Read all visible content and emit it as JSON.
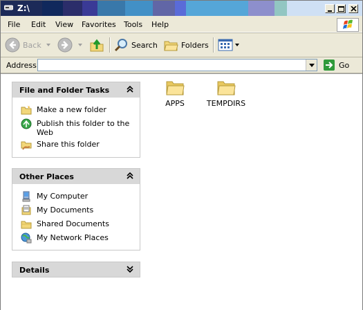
{
  "window": {
    "title": "Z:\\"
  },
  "menubar": {
    "items": [
      {
        "label": "File"
      },
      {
        "label": "Edit"
      },
      {
        "label": "View"
      },
      {
        "label": "Favorites"
      },
      {
        "label": "Tools"
      },
      {
        "label": "Help"
      }
    ]
  },
  "toolbar": {
    "back_label": "Back",
    "search_label": "Search",
    "folders_label": "Folders"
  },
  "addressbar": {
    "label": "Address",
    "value": "",
    "go_label": "Go"
  },
  "tasks_panel": {
    "title": "File and Folder Tasks",
    "items": [
      {
        "label": "Make a new folder",
        "icon": "new-folder-icon"
      },
      {
        "label": "Publish this folder to the Web",
        "icon": "publish-web-icon"
      },
      {
        "label": "Share this folder",
        "icon": "share-folder-icon"
      }
    ]
  },
  "places_panel": {
    "title": "Other Places",
    "items": [
      {
        "label": "My Computer",
        "icon": "my-computer-icon"
      },
      {
        "label": "My Documents",
        "icon": "my-documents-icon"
      },
      {
        "label": "Shared Documents",
        "icon": "shared-documents-icon"
      },
      {
        "label": "My Network Places",
        "icon": "network-places-icon"
      }
    ]
  },
  "details_panel": {
    "title": "Details"
  },
  "files": [
    {
      "name": "APPS",
      "icon": "folder-icon"
    },
    {
      "name": "TEMPDIRS",
      "icon": "folder-icon"
    }
  ],
  "colors": {
    "titlebar_blocks": [
      "#1c2a58",
      "#10285c",
      "#2b2d6a",
      "#3a3a96",
      "#3978aa",
      "#4290c6",
      "#6166a6",
      "#5a6bd8",
      "#55a6d8",
      "#8d8fcc",
      "#92c6c2",
      "#cfe0f4"
    ],
    "go_green": "#2f9a3a"
  }
}
